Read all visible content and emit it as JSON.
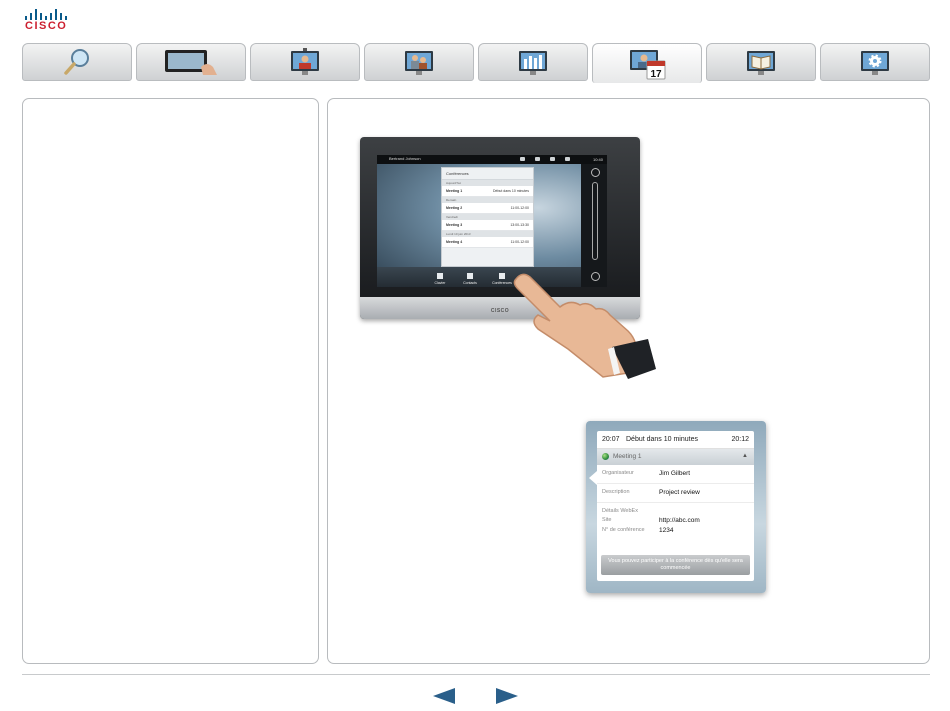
{
  "brand": {
    "logo_text": "CISCO"
  },
  "tabs": [
    {
      "name": "search",
      "icon": "magnifier-icon"
    },
    {
      "name": "touchpad",
      "icon": "touch-screen-icon"
    },
    {
      "name": "video-call",
      "icon": "person-on-monitor-icon"
    },
    {
      "name": "multisite",
      "icon": "two-persons-monitor-icon"
    },
    {
      "name": "presentation",
      "icon": "chart-monitor-icon"
    },
    {
      "name": "scheduled-meetings",
      "icon": "calendar-monitor-icon",
      "active": true,
      "calendar_day": "17"
    },
    {
      "name": "contacts",
      "icon": "book-monitor-icon"
    },
    {
      "name": "settings",
      "icon": "gear-monitor-icon"
    }
  ],
  "device_screen": {
    "user": "Bertrand Johnson",
    "time": "10:40",
    "conference_panel": {
      "title": "Conférences",
      "groups": [
        {
          "label": "Aujourd'hui",
          "meetings": [
            {
              "name": "Meeting 1",
              "time": "Début dans 10 minutes"
            }
          ]
        },
        {
          "label": "Demain",
          "meetings": [
            {
              "name": "Meeting 2",
              "time": "11:00-12:00"
            }
          ]
        },
        {
          "label": "Vendredi",
          "meetings": [
            {
              "name": "Meeting 3",
              "time": "13:00-13:30"
            }
          ]
        },
        {
          "label": "Lundi 10 juin 2013",
          "meetings": [
            {
              "name": "Meeting 4",
              "time": "11:00-12:00"
            }
          ]
        }
      ]
    },
    "nav": [
      "Clavier",
      "Contacts",
      "Conférences"
    ],
    "brand_label": "CISCO"
  },
  "meeting_detail": {
    "start": "20:07",
    "status": "Début dans 10 minutes",
    "end": "20:12",
    "meeting_name": "Meeting 1",
    "fields": [
      {
        "label": "Organisateur",
        "value": "Jim Gilbert"
      },
      {
        "label": "Description",
        "value": "Project review"
      }
    ],
    "webex_section": "Détails WebEx",
    "webex": [
      {
        "label": "Site",
        "value": "http://abc.com"
      },
      {
        "label": "N° de conférence",
        "value": "1234"
      }
    ],
    "join_text": "Vous pouvez participer à la conférence dès qu'elle sera commencée"
  },
  "colors": {
    "accent": "#2a5f8a",
    "logo_red": "#cc1f2f"
  }
}
